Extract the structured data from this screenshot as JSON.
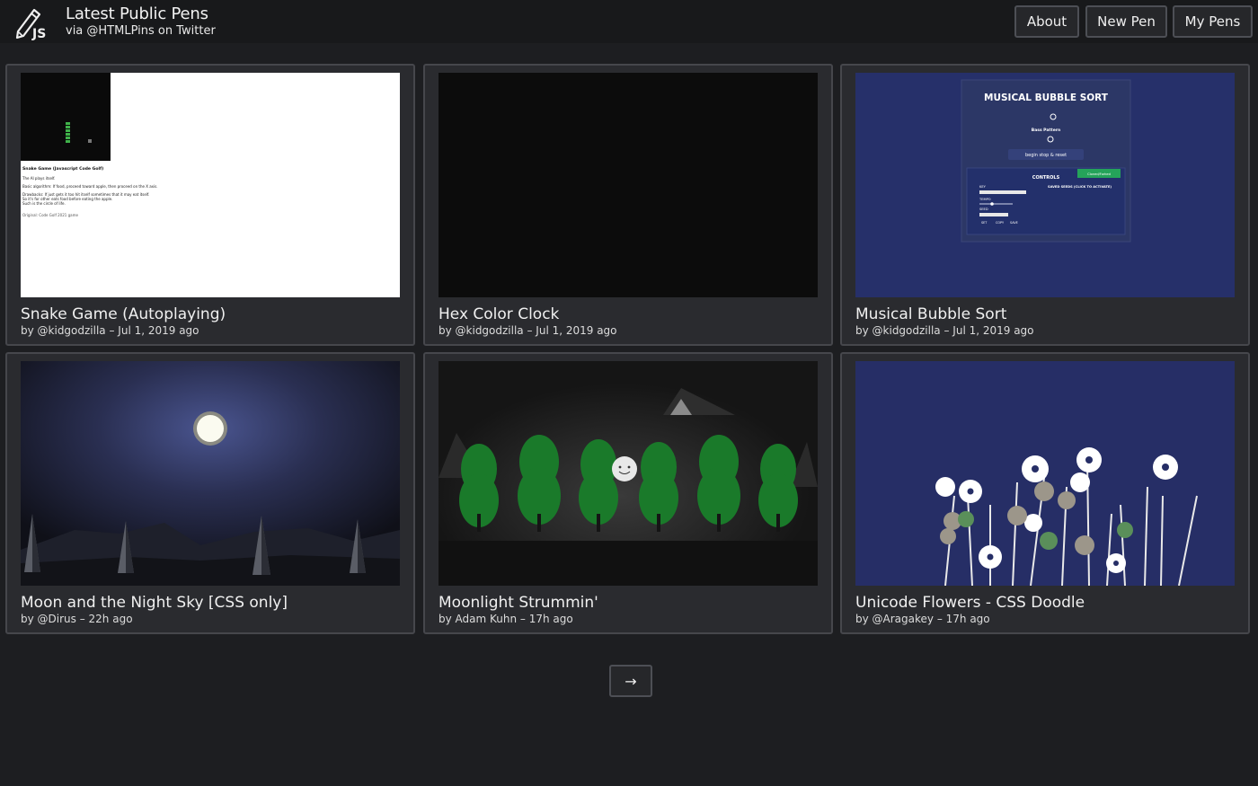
{
  "header": {
    "title": "Latest Public Pens",
    "subtitle": "via @HTMLPins on Twitter",
    "logo_text": "JS",
    "nav": [
      {
        "label": "About"
      },
      {
        "label": "New Pen"
      },
      {
        "label": "My Pens"
      }
    ]
  },
  "pens": [
    {
      "title": "Snake Game (Autoplaying)",
      "meta": "by @kidgodzilla – Jul 1, 2019 ago",
      "preview": "snake"
    },
    {
      "title": "Hex Color Clock",
      "meta": "by @kidgodzilla – Jul 1, 2019 ago",
      "preview": "black"
    },
    {
      "title": "Musical Bubble Sort",
      "meta": "by @kidgodzilla – Jul 1, 2019 ago",
      "preview": "bubble-sort"
    },
    {
      "title": "Moon and the Night Sky [CSS only]",
      "meta": "by @Dirus – 22h ago",
      "preview": "night-sky"
    },
    {
      "title": "Moonlight Strummin'",
      "meta": "by Adam Kuhn – 17h ago",
      "preview": "forest"
    },
    {
      "title": "Unicode Flowers - CSS Doodle",
      "meta": "by @Aragakey – 17h ago",
      "preview": "flowers"
    }
  ],
  "previews": {
    "snake": {
      "heading": "Snake Game (Javascript Code Golf)",
      "lines": [
        "The AI plays itself.",
        "Basic algorithm: If food, proceed toward apple, then proceed on the X axis.",
        "Drawbacks: If just gets it too hit itself sometimes that it may eat itself.",
        "So it's for other eats food before eating the apple.",
        "Such is the circle of life."
      ],
      "footer": "Original: Code Golf 2021 game"
    },
    "bubble_sort": {
      "heading": "MUSICAL BUBBLE SORT",
      "bass_label": "Bass Pattern",
      "begin_label": "begin stop & reset",
      "controls_label": "CONTROLS",
      "saved_label": "SAVED SEEDS (CLICK TO ACTIVATE)",
      "green_btn": "Cloned/Forked",
      "key": "KEY",
      "tempo": "TEMPO",
      "seed": "SEED",
      "set": "SET",
      "copy": "COPY",
      "save": "SAVE"
    }
  },
  "pagination": {
    "next_label": "→"
  },
  "colors": {
    "background": "#1d1e21",
    "card": "#2a2b2f",
    "card_border": "#46474c",
    "bubble_bg": "#26306a",
    "flowers_bg": "#262e66",
    "forest_green": "#1a7a2a"
  }
}
